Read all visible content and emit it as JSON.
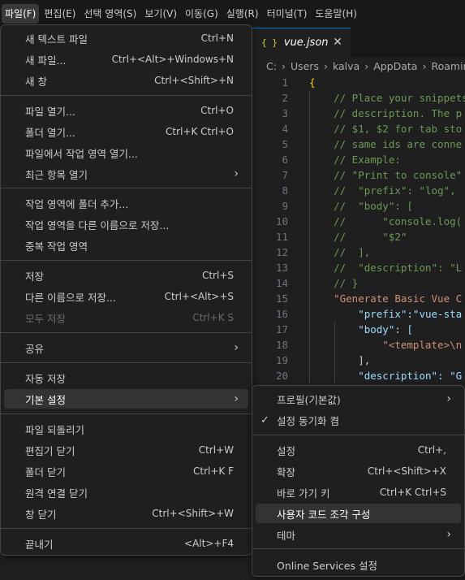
{
  "menubar": {
    "items": [
      "파일(F)",
      "편집(E)",
      "선택 영역(S)",
      "보기(V)",
      "이동(G)",
      "실행(R)",
      "터미널(T)",
      "도움말(H)"
    ]
  },
  "editor": {
    "tab": {
      "icon": "{ }",
      "label": "vue.json",
      "close": "✕"
    },
    "breadcrumb": [
      "C:",
      "Users",
      "kalva",
      "AppData",
      "Roaming"
    ],
    "lines": [
      {
        "n": "1",
        "t": "{"
      },
      {
        "n": "2",
        "t": "    // Place your snippets"
      },
      {
        "n": "3",
        "t": "    // description. The p"
      },
      {
        "n": "4",
        "t": "    // $1, $2 for tab sto"
      },
      {
        "n": "5",
        "t": "    // same ids are conne"
      },
      {
        "n": "6",
        "t": "    // Example:"
      },
      {
        "n": "7",
        "t": "    // \"Print to console\""
      },
      {
        "n": "8",
        "t": "    //  \"prefix\": \"log\","
      },
      {
        "n": "9",
        "t": "    //  \"body\": ["
      },
      {
        "n": "10",
        "t": "    //      \"console.log("
      },
      {
        "n": "11",
        "t": "    //      \"$2\""
      },
      {
        "n": "12",
        "t": "    //  ],"
      },
      {
        "n": "13",
        "t": "    //  \"description\": \"L"
      },
      {
        "n": "14",
        "t": "    // }"
      },
      {
        "n": "15",
        "t": "    \"Generate Basic Vue C"
      },
      {
        "n": "16",
        "t": "        \"prefix\":\"vue-sta"
      },
      {
        "n": "17",
        "t": "        \"body\": ["
      },
      {
        "n": "18",
        "t": "            \"<template>\\n"
      },
      {
        "n": "19",
        "t": "        ],"
      },
      {
        "n": "20",
        "t": "        \"description\": \"G"
      }
    ]
  },
  "file_menu": {
    "items": [
      {
        "label": "새 텍스트 파일",
        "kb": "Ctrl+N"
      },
      {
        "label": "새 파일...",
        "kb": "Ctrl+<Alt>+Windows+N"
      },
      {
        "label": "새 창",
        "kb": "Ctrl+<Shift>+N"
      },
      {
        "label": "파일 열기...",
        "kb": "Ctrl+O"
      },
      {
        "label": "폴더 열기...",
        "kb": "Ctrl+K Ctrl+O"
      },
      {
        "label": "파일에서 작업 영역 열기...",
        "kb": ""
      },
      {
        "label": "최근 항목 열기",
        "kb": ""
      },
      {
        "label": "작업 영역에 폴더 추가...",
        "kb": ""
      },
      {
        "label": "작업 영역을 다른 이름으로 저장...",
        "kb": ""
      },
      {
        "label": "중복 작업 영역",
        "kb": ""
      },
      {
        "label": "저장",
        "kb": "Ctrl+S"
      },
      {
        "label": "다른 이름으로 저장...",
        "kb": "Ctrl+<Alt>+S"
      },
      {
        "label": "모두 저장",
        "kb": "Ctrl+K S"
      },
      {
        "label": "공유",
        "kb": ""
      },
      {
        "label": "자동 저장",
        "kb": ""
      },
      {
        "label": "기본 설정",
        "kb": ""
      },
      {
        "label": "파일 되돌리기",
        "kb": ""
      },
      {
        "label": "편집기 닫기",
        "kb": "Ctrl+W"
      },
      {
        "label": "폴더 닫기",
        "kb": "Ctrl+K F"
      },
      {
        "label": "원격 연결 닫기",
        "kb": ""
      },
      {
        "label": "창 닫기",
        "kb": "Ctrl+<Shift>+W"
      },
      {
        "label": "끝내기",
        "kb": "<Alt>+F4"
      }
    ]
  },
  "prefs_menu": {
    "items": [
      {
        "label": "프로필(기본값)",
        "kb": ""
      },
      {
        "label": "설정 동기화 켬",
        "kb": ""
      },
      {
        "label": "설정",
        "kb": "Ctrl+,"
      },
      {
        "label": "확장",
        "kb": "Ctrl+<Shift>+X"
      },
      {
        "label": "바로 가기 키",
        "kb": "Ctrl+K Ctrl+S"
      },
      {
        "label": "사용자 코드 조각 구성",
        "kb": ""
      },
      {
        "label": "테마",
        "kb": ""
      },
      {
        "label": "Online Services 설정",
        "kb": ""
      }
    ]
  },
  "icons": {
    "chevron_right": "›",
    "check": "✓"
  },
  "colors": {
    "accent": "#0078d4",
    "menu_bg": "#1f1f1f",
    "highlight": "#2c3c4f",
    "comment": "#6a9955",
    "string": "#ce9178",
    "key": "#9cdcfe"
  }
}
